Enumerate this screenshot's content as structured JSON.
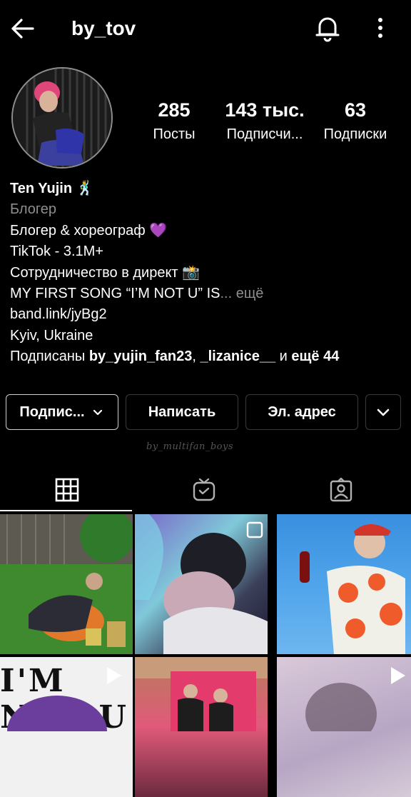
{
  "header": {
    "username": "by_tov",
    "icons": {
      "back": "arrow-left-icon",
      "notifications": "bell-icon",
      "more": "dots-vertical-icon"
    }
  },
  "profile": {
    "avatar": "avatar",
    "stats": [
      {
        "value": "285",
        "label": "Посты"
      },
      {
        "value": "143 тыс.",
        "label": "Подписчи..."
      },
      {
        "value": "63",
        "label": "Подписки"
      }
    ]
  },
  "bio": {
    "name": "Ten Yujin 🕺",
    "category": "Блогер",
    "lines": [
      "Блогер & хореограф 💜",
      "TikTok - 3.1M+",
      "Сотрудничество в директ 📸",
      "MY FIRST SONG “I’M NOT U” IS"
    ],
    "more_label": "... ещё",
    "link": "band.link/jyBg2",
    "location": "Kyiv, Ukraine",
    "followed_by_prefix": "Подписаны ",
    "followed_by_user1": "by_yujin_fan23",
    "followed_by_sep": ", ",
    "followed_by_user2": "_lizanice__",
    "followed_by_and": " и ",
    "followed_by_rest": "ещё 44"
  },
  "actions": {
    "following_label": "Подпис...",
    "message_label": "Написать",
    "email_label": "Эл. адрес"
  },
  "watermark": "by_multifan_boys",
  "tabs": [
    {
      "name": "posts-grid",
      "icon": "grid-icon",
      "active": true
    },
    {
      "name": "igtv",
      "icon": "tv-icon",
      "active": false
    },
    {
      "name": "tagged",
      "icon": "person-tag-icon",
      "active": false
    }
  ],
  "grid": {
    "tile4_text": "I'M NOT U"
  },
  "colors": {
    "background": "#000000",
    "muted_text": "#8e8e8e",
    "accent_heart": "#a335e8"
  }
}
